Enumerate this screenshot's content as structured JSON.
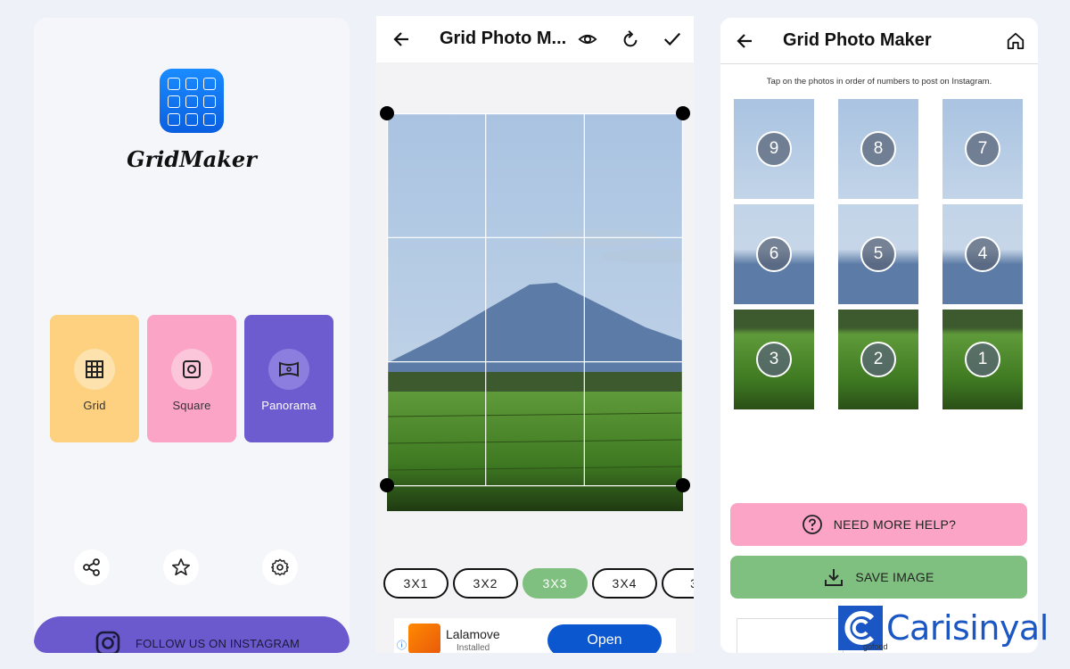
{
  "home": {
    "brand_name": "GridMaker",
    "modes": [
      {
        "label": "Grid",
        "icon": "grid-icon"
      },
      {
        "label": "Square",
        "icon": "square-camera-icon"
      },
      {
        "label": "Panorama",
        "icon": "panorama-icon"
      }
    ],
    "actions": [
      "share-icon",
      "star-icon",
      "settings-icon"
    ],
    "follow_label": "FOLLOW US ON INSTAGRAM"
  },
  "editor": {
    "title": "Grid Photo M...",
    "ratios": [
      "3X1",
      "3X2",
      "3X3",
      "3X4",
      "3"
    ],
    "active_ratio": "3X3",
    "ad": {
      "name": "Lalamove",
      "status": "Installed",
      "cta": "Open"
    }
  },
  "result": {
    "title": "Grid Photo Maker",
    "instruction": "Tap on the photos in order of numbers to post on Instagram.",
    "tiles": [
      "9",
      "8",
      "7",
      "6",
      "5",
      "4",
      "3",
      "2",
      "1"
    ],
    "help_label": "NEED MORE HELP?",
    "save_label": "SAVE IMAGE"
  },
  "watermark": {
    "text": "Carisinyal",
    "ad_text": "gofood"
  },
  "colors": {
    "accent_purple": "#6a5acd",
    "pink": "#fba4c6",
    "green": "#7fbf7f",
    "yellow": "#fdd17f"
  }
}
